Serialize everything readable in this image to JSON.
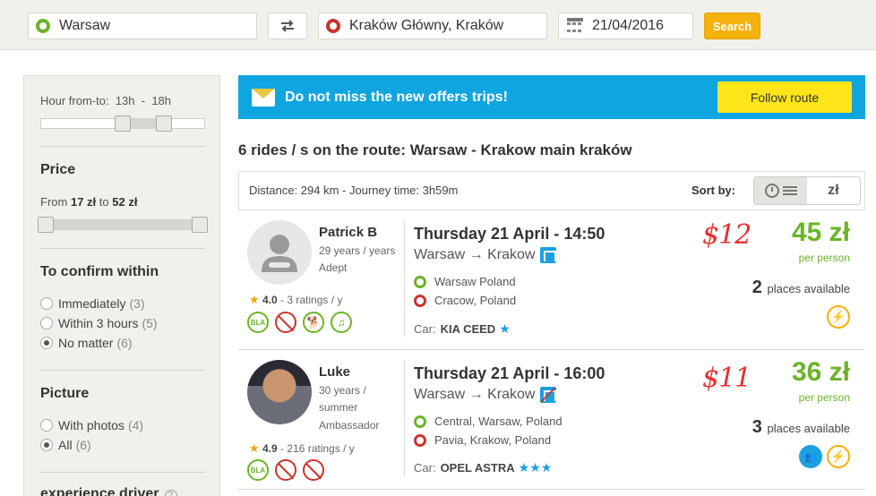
{
  "search": {
    "from": "Warsaw",
    "to": "Kraków Główny, Kraków",
    "date": "21/04/2016",
    "button": "Search"
  },
  "filters": {
    "hour_label": "Hour from-to:",
    "hour_from": "13h",
    "hour_sep": "-",
    "hour_to": "18h",
    "price_heading": "Price",
    "price_from_label": "From",
    "price_min": "17 zł",
    "price_to_label": "to",
    "price_max": "52 zł",
    "confirm_heading": "To confirm within",
    "confirm_options": [
      {
        "label": "Immediately",
        "count": "(3)",
        "checked": false
      },
      {
        "label": "Within 3 hours",
        "count": "(5)",
        "checked": false
      },
      {
        "label": "No matter",
        "count": "(6)",
        "checked": true
      }
    ],
    "picture_heading": "Picture",
    "picture_options": [
      {
        "label": "With photos",
        "count": "(4)",
        "checked": false
      },
      {
        "label": "All",
        "count": "(6)",
        "checked": true
      }
    ],
    "experience_heading": "experience driver"
  },
  "banner": {
    "text": "Do not miss the new offers trips!",
    "button": "Follow route"
  },
  "results": {
    "title": "6 rides / s on the route: Warsaw - Krakow main kraków",
    "distance": "Distance: 294 km - Journey time: 3h59m",
    "sort_label": "Sort by:",
    "sort_price": "zł"
  },
  "rides": [
    {
      "driver": "Patrick B",
      "meta": [
        "29 years / years",
        "Adept"
      ],
      "rating": "4.0",
      "ratings_count": "- 3 ratings / y",
      "when": "Thursday 21 April - 14:50",
      "from": "Warsaw",
      "arrow": "→",
      "to": "Krakow",
      "stop_from": "Warsaw Poland",
      "stop_to": "Cracow, Poland",
      "car_label": "Car:",
      "car": "KIA CEED",
      "car_stars": "★",
      "handwritten": "$12",
      "price": "45 zł",
      "per_person": "per person",
      "places": "2",
      "places_label": "places available"
    },
    {
      "driver": "Luke",
      "meta": [
        "30 years /",
        "summer",
        "Ambassador"
      ],
      "rating": "4.9",
      "ratings_count": "- 216 ratings / y",
      "when": "Thursday 21 April - 16:00",
      "from": "Warsaw",
      "arrow": "→",
      "to": "Krakow",
      "stop_from": "Central, Warsaw, Poland",
      "stop_to": "Pavia, Krakow, Poland",
      "car_label": "Car:",
      "car": "OPEL ASTRA",
      "car_stars": "★★★",
      "handwritten": "$11",
      "price": "36 zł",
      "per_person": "per person",
      "places": "3",
      "places_label": "places available"
    }
  ],
  "pref_labels": {
    "bla": "BLA",
    "music": "♫",
    "pet": "🐕",
    "people": "👥",
    "bolt": "⚡"
  },
  "colors": {
    "accent_green": "#6cb32a",
    "accent_blue": "#0fa5e0",
    "search_yellow": "#f6b20d",
    "annotation_red": "#e53030"
  }
}
